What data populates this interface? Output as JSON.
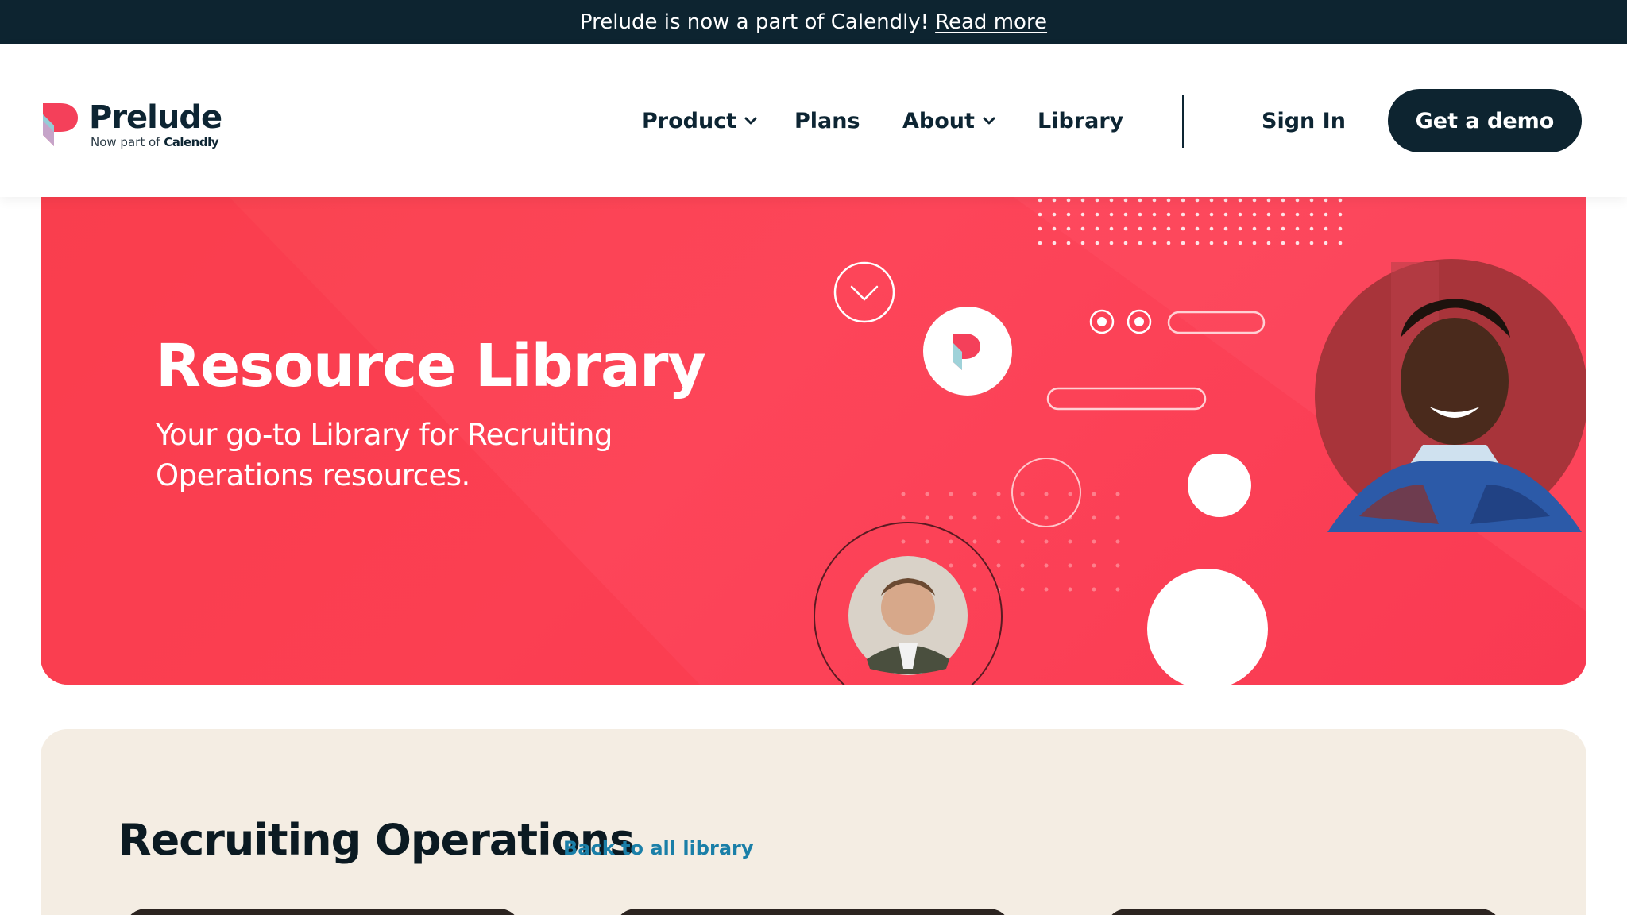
{
  "announcement": {
    "text": "Prelude is now a part of Calendly!",
    "link": "Read more"
  },
  "header": {
    "logo": {
      "name": "Prelude",
      "tagline_prefix": "Now part of",
      "tagline_brand": "Calendly"
    },
    "nav": [
      {
        "label": "Product",
        "dropdown": true
      },
      {
        "label": "Plans",
        "dropdown": false
      },
      {
        "label": "About",
        "dropdown": true
      },
      {
        "label": "Library",
        "dropdown": false
      }
    ],
    "sign_in": "Sign In",
    "cta": "Get a demo"
  },
  "hero": {
    "title": "Resource Library",
    "subtitle": "Your go-to Library for Recruiting Operations resources."
  },
  "section": {
    "title": "Recruiting Operations",
    "back_link": "Back to all library"
  },
  "colors": {
    "dark": "#0d2430",
    "hero_red": "#fd4559",
    "cream": "#f4ede3",
    "link": "#1a7fa8"
  }
}
